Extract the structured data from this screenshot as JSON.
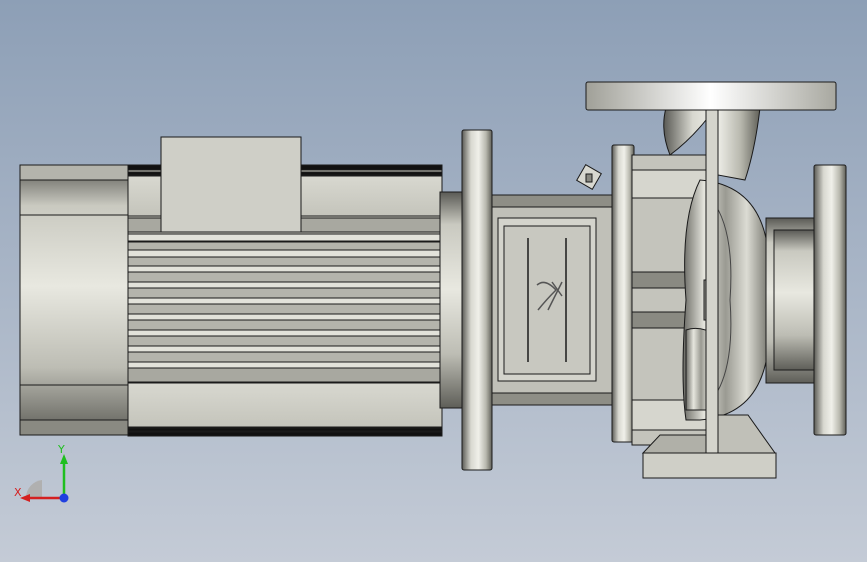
{
  "viewport": {
    "background_top": "#8d9fb6",
    "background_bottom": "#c4cbd6"
  },
  "model": {
    "colors": {
      "metal_light": "#e4e4dc",
      "metal_mid": "#c8c8be",
      "metal_dark": "#6e6e68",
      "edge": "#1a1a1a"
    }
  },
  "triad": {
    "x_label": "X",
    "y_label": "Y",
    "x_color": "#d42020",
    "y_color": "#1fbf1f",
    "z_color": "#2040e0"
  }
}
